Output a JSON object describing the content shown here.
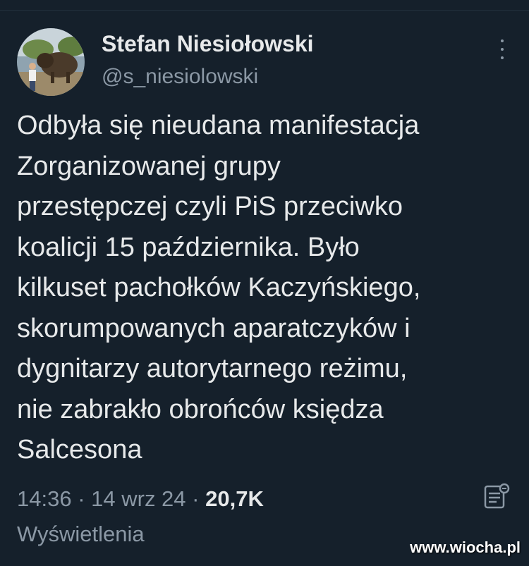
{
  "author": {
    "name": "Stefan Niesiołowski",
    "handle": "@s_niesiolowski"
  },
  "tweet": {
    "lines": [
      "Odbyła się nieudana manifestacja",
      "Zorganizowanej grupy",
      "przestępczej czyli PiS przeciwko",
      "koalicji 15 października. Było",
      "kilkuset pachołków Kaczyńskiego,",
      "skorumpowanych aparatczyków i",
      "dygnitarzy autorytarnego reżimu,",
      "nie zabrakło obrońców księdza",
      "Salcesona"
    ]
  },
  "meta": {
    "time": "14:36",
    "separator": " · ",
    "date": "14 wrz 24",
    "views_count": "20,7K",
    "views_label": "Wyświetlenia"
  },
  "icons": {
    "more": "more-vertical-icon",
    "notes": "community-notes-icon"
  },
  "watermark": "www.wiocha.pl",
  "colors": {
    "background": "#15202b",
    "text": "#e7e9ea",
    "secondary": "#8b98a5"
  }
}
